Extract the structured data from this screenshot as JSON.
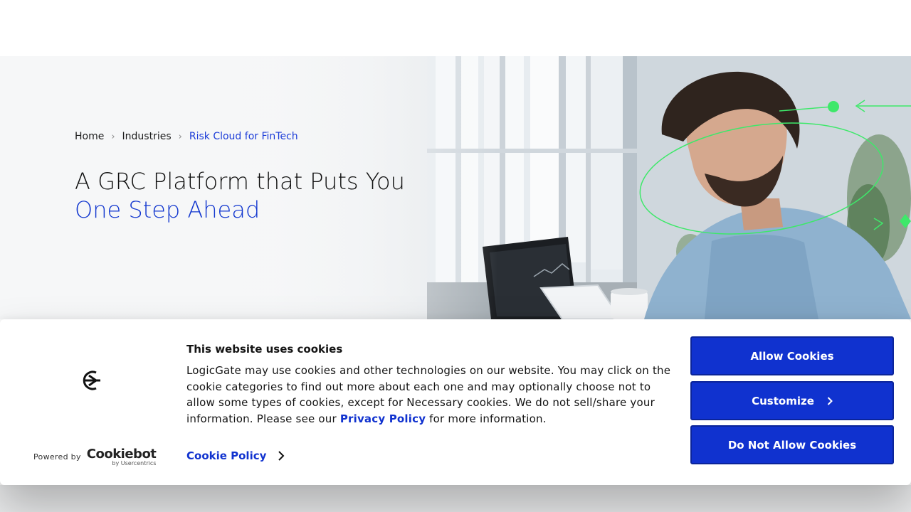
{
  "breadcrumb": {
    "home": "Home",
    "industries": "Industries",
    "current": "Risk Cloud for FinTech"
  },
  "hero": {
    "title_line1": "A GRC Platform that Puts You",
    "title_line2": "One Step Ahead"
  },
  "cookie_banner": {
    "title": "This website uses cookies",
    "body_before_link": "LogicGate may use cookies and other technologies on our website. You may click on the cookie categories to find out more about each one and may optionally choose not to allow some types of cookies, except for Necessary cookies.  We do not sell/share your information. Please see our ",
    "privacy_link": "Privacy Policy",
    "body_after_link": " for more information.",
    "cookie_policy_link": "Cookie Policy",
    "powered_by": "Powered by",
    "brand": "Cookiebot",
    "brand_sub": "by Usercentrics",
    "buttons": {
      "allow": "Allow Cookies",
      "customize": "Customize",
      "deny": "Do Not Allow Cookies"
    }
  },
  "colors": {
    "brand_blue": "#1032cf",
    "accent_green": "#3ee86a"
  }
}
